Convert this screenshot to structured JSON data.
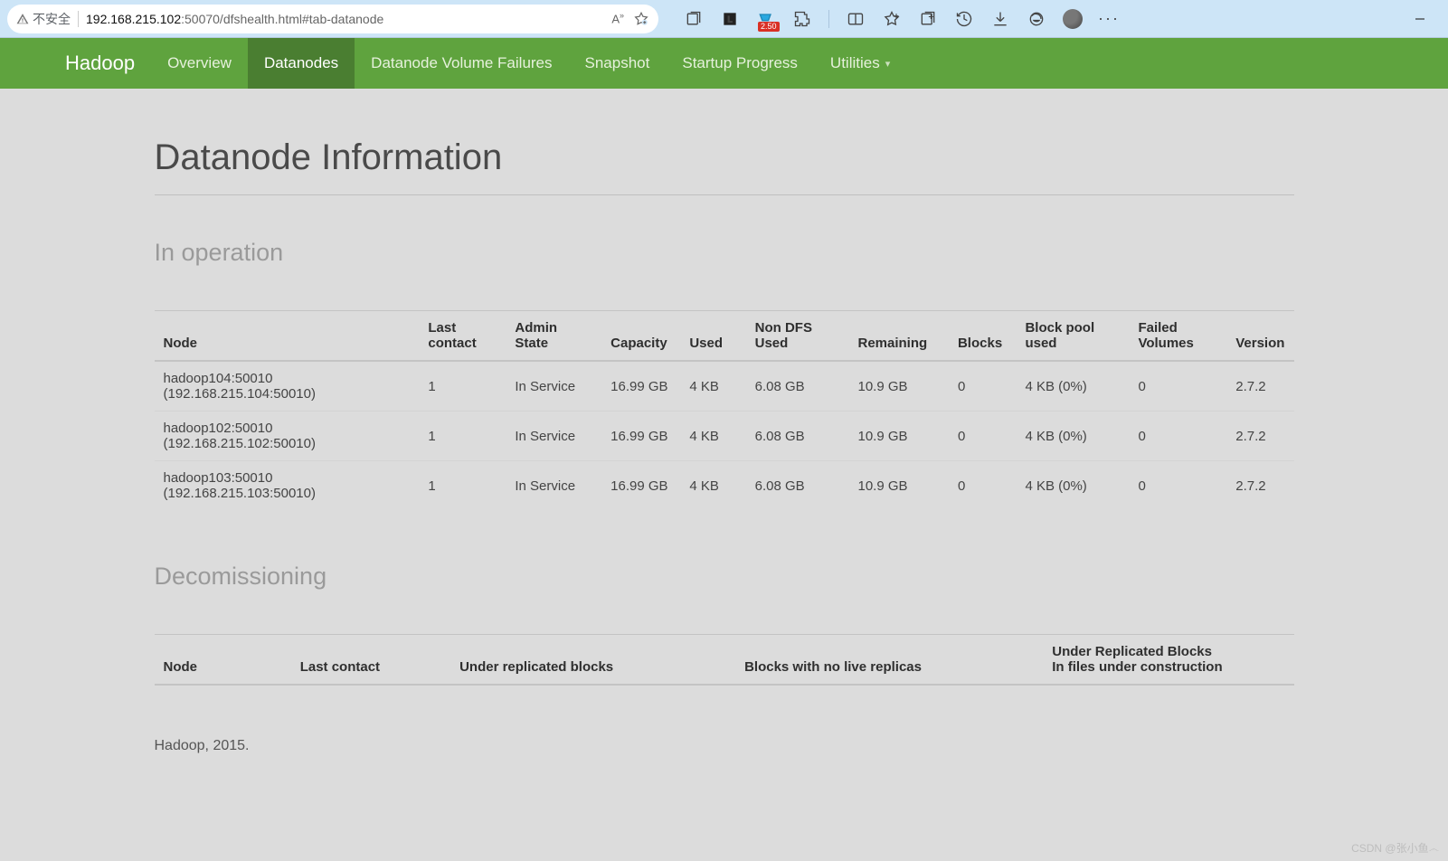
{
  "browser": {
    "security_label": "不安全",
    "url_host": "192.168.215.102",
    "url_rest": ":50070/dfshealth.html#tab-datanode",
    "badge": "2.50"
  },
  "nav": {
    "brand": "Hadoop",
    "items": [
      {
        "label": "Overview",
        "active": false
      },
      {
        "label": "Datanodes",
        "active": true
      },
      {
        "label": "Datanode Volume Failures",
        "active": false
      },
      {
        "label": "Snapshot",
        "active": false
      },
      {
        "label": "Startup Progress",
        "active": false
      },
      {
        "label": "Utilities",
        "active": false,
        "dropdown": true
      }
    ]
  },
  "page": {
    "title": "Datanode Information",
    "section_in_operation": "In operation",
    "section_decom": "Decomissioning",
    "footer": "Hadoop, 2015."
  },
  "in_operation": {
    "headers": [
      "Node",
      "Last contact",
      "Admin State",
      "Capacity",
      "Used",
      "Non DFS Used",
      "Remaining",
      "Blocks",
      "Block pool used",
      "Failed Volumes",
      "Version"
    ],
    "rows": [
      {
        "node": "hadoop104:50010 (192.168.215.104:50010)",
        "last_contact": "1",
        "admin_state": "In Service",
        "capacity": "16.99 GB",
        "used": "4 KB",
        "non_dfs": "6.08 GB",
        "remaining": "10.9 GB",
        "blocks": "0",
        "block_pool": "4 KB (0%)",
        "failed_volumes": "0",
        "version": "2.7.2"
      },
      {
        "node": "hadoop102:50010 (192.168.215.102:50010)",
        "last_contact": "1",
        "admin_state": "In Service",
        "capacity": "16.99 GB",
        "used": "4 KB",
        "non_dfs": "6.08 GB",
        "remaining": "10.9 GB",
        "blocks": "0",
        "block_pool": "4 KB (0%)",
        "failed_volumes": "0",
        "version": "2.7.2"
      },
      {
        "node": "hadoop103:50010 (192.168.215.103:50010)",
        "last_contact": "1",
        "admin_state": "In Service",
        "capacity": "16.99 GB",
        "used": "4 KB",
        "non_dfs": "6.08 GB",
        "remaining": "10.9 GB",
        "blocks": "0",
        "block_pool": "4 KB (0%)",
        "failed_volumes": "0",
        "version": "2.7.2"
      }
    ]
  },
  "decom": {
    "headers": [
      "Node",
      "Last contact",
      "Under replicated blocks",
      "Blocks with no live replicas",
      "Under Replicated Blocks\nIn files under construction"
    ],
    "rows": []
  },
  "watermark": "CSDN @张小鱼෴"
}
